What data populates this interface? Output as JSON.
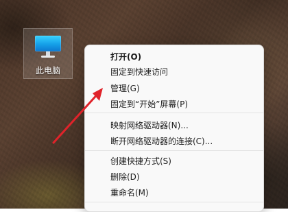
{
  "desktop": {
    "icon": {
      "name": "monitor-icon",
      "label": "此电脑"
    }
  },
  "context_menu": {
    "items": [
      {
        "label": "打开(O)"
      },
      {
        "label": "固定到快速访问"
      },
      {
        "label": "管理(G)"
      },
      {
        "label": "固定到“开始”屏幕(P)"
      },
      {
        "label": "映射网络驱动器(N)..."
      },
      {
        "label": "断开网络驱动器的连接(C)..."
      },
      {
        "label": "创建快捷方式(S)"
      },
      {
        "label": "删除(D)"
      },
      {
        "label": "重命名(M)"
      }
    ]
  },
  "colors": {
    "annotation_arrow": "#e0232a",
    "monitor_screen": "#1aa7ee",
    "menu_background": "#f9f9f9"
  }
}
